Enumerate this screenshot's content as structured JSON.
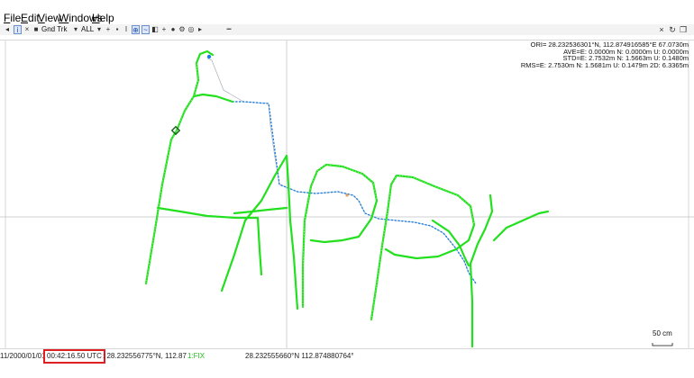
{
  "menu": {
    "file": "ile",
    "edit": "dit",
    "view": "iew",
    "windows": "indows",
    "help": "elp",
    "file_key": "F",
    "edit_key": "E",
    "view_key": "V",
    "windows_key": "W",
    "help_key": "H"
  },
  "toolbar": {
    "mode": "Gnd Trk",
    "filter": "ALL"
  },
  "stats": {
    "ori": "ORI= 28.232536301°N, 112.874916585°E 67.0730m",
    "ave": "AVE=E: 0.0000m N: 0.0000m U: 0.0000m",
    "std": "STD=E: 2.7532m N: 1.5663m U: 0.1480m",
    "rms": "RMS=E: 2.7530m N: 1.5681m U: 0.1479m 2D: 6.3365m"
  },
  "scale": {
    "label": "50 cm"
  },
  "status": {
    "date": "11/2000/01/01",
    "time": "00:42:16.50 UTC",
    "pos1": ": 28.232556775°N, 112.87",
    "fix": "1:FIX",
    "pos2": "28.232555660°N  112.874880764°"
  },
  "colors": {
    "track": "#22e01e",
    "reference": "#1e7fe0",
    "highlight": "#e02020"
  }
}
